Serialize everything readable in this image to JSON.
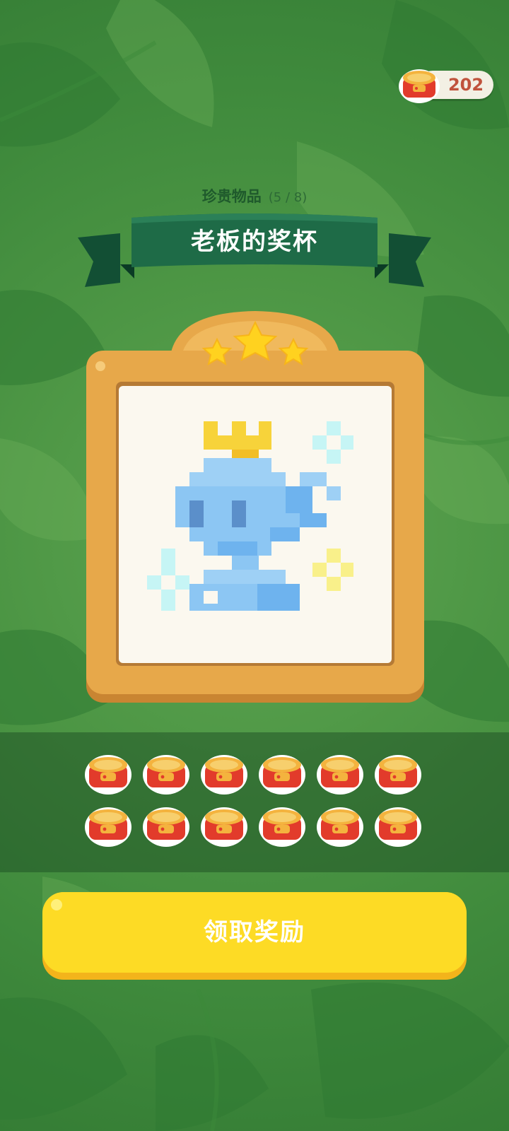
{
  "currency": {
    "icon": "cat-food-can-icon",
    "amount": "202"
  },
  "collection": {
    "category": "珍贵物品",
    "progress": "(5 / 8)"
  },
  "item": {
    "title": "老板的奖杯",
    "stars_earned": 3,
    "stars_total": 3,
    "image": "pixel-trophy-fish-with-crown"
  },
  "reward": {
    "icon": "cat-food-can-icon",
    "count": 12
  },
  "claim_button": {
    "label": "领取奖励"
  },
  "colors": {
    "background": "#4f9846",
    "ribbon": "#1e6b47",
    "frame": "#e7a84a",
    "button": "#fddb25",
    "currency_text": "#c0533c"
  }
}
